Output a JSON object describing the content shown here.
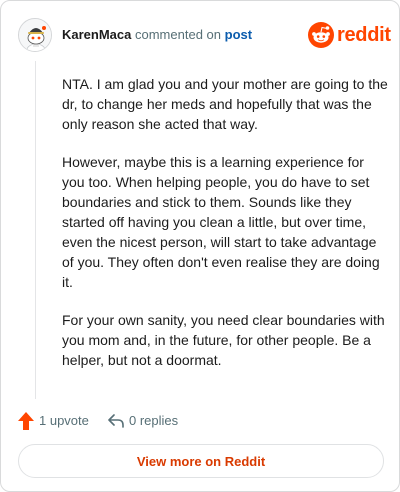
{
  "header": {
    "author": "KarenMaca",
    "action_text": "commented on",
    "post_link": "post",
    "avatar_icon": "snoo-avatar-icon",
    "logo": {
      "icon": "reddit-snoo-icon",
      "wordmark": "reddit",
      "color": "#ff4500"
    }
  },
  "comment": {
    "paragraphs": [
      "NTA. I am glad you and your mother are going to the dr, to change her meds and hopefully that was the only reason she acted that way.",
      "However, maybe this is a learning experience for you too. When helping people, you do have to set boundaries and stick to them. Sounds like they started off having you clean a little, but over time, even the nicest person, will start to take advantage of you. They often don't even realise they are doing it.",
      "For your own sanity, you need clear boundaries with you mom and, in the future, for other people. Be a helper, but not a doormat."
    ]
  },
  "actions": {
    "upvote_label": "1 upvote",
    "upvote_icon": "upvote-arrow-icon",
    "upvote_color": "#ff4500",
    "replies_label": "0 replies",
    "reply_icon": "reply-arrow-icon"
  },
  "footer": {
    "view_more_label": "View more on Reddit",
    "accent_color": "#d93a00"
  }
}
